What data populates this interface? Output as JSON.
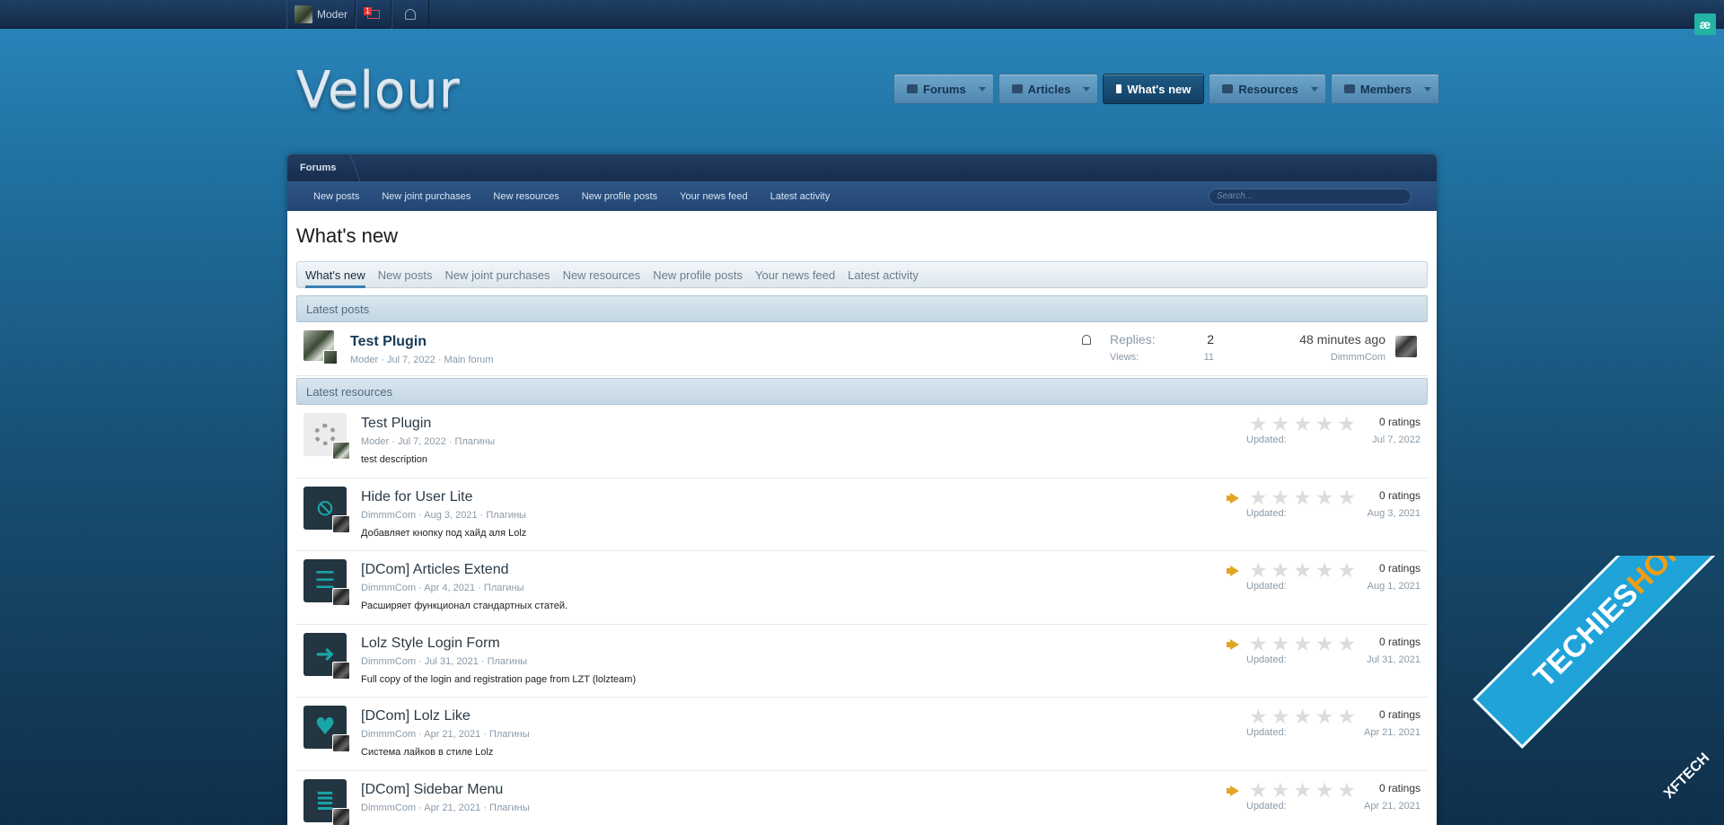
{
  "topbar": {
    "username": "Moder",
    "mail_badge": "1"
  },
  "corner_badge": "æ",
  "logo": "Velour",
  "mainnav": [
    {
      "label": "Forums",
      "icon": "comments-icon",
      "active": false
    },
    {
      "label": "Articles",
      "icon": "newspaper-icon",
      "active": false
    },
    {
      "label": "What's new",
      "icon": "bolt-icon",
      "active": true
    },
    {
      "label": "Resources",
      "icon": "download-icon",
      "active": false
    },
    {
      "label": "Members",
      "icon": "users-icon",
      "active": false
    }
  ],
  "breadcrumb": "Forums",
  "subnav": [
    "New posts",
    "New joint purchases",
    "New resources",
    "New profile posts",
    "Your news feed",
    "Latest activity"
  ],
  "search_placeholder": "Search...",
  "page_title": "What's new",
  "tabs": [
    "What's new",
    "New posts",
    "New joint purchases",
    "New resources",
    "New profile posts",
    "Your news feed",
    "Latest activity"
  ],
  "latest_posts_heading": "Latest posts",
  "post": {
    "title": "Test Plugin",
    "meta": "Moder · Jul 7, 2022 · Main forum",
    "replies_label": "Replies:",
    "replies": "2",
    "views_label": "Views:",
    "views": "11",
    "last_time": "48 minutes ago",
    "last_user": "DimmmCom"
  },
  "latest_resources_heading": "Latest resources",
  "resources": [
    {
      "title": "Test Plugin",
      "meta": "Moder · Jul 7, 2022 · Плагины",
      "desc": "test description",
      "ratings": "0 ratings",
      "updated_label": "Updated:",
      "updated": "Jul 7, 2022",
      "featured": false,
      "icon": "gear-icon"
    },
    {
      "title": "Hide for User Lite",
      "meta": "DimmmCom · Aug 3, 2021 · Плагины",
      "desc": "Добавляет кнопку под хайд аля Lolz",
      "ratings": "0 ratings",
      "updated_label": "Updated:",
      "updated": "Aug 3, 2021",
      "featured": true,
      "icon": "eye-slash-icon"
    },
    {
      "title": "[DCom] Articles Extend",
      "meta": "DimmmCom · Apr 4, 2021 · Плагины",
      "desc": "Расширяет функционал стандартных статей.",
      "ratings": "0 ratings",
      "updated_label": "Updated:",
      "updated": "Aug 1, 2021",
      "featured": true,
      "icon": "article-icon"
    },
    {
      "title": "Lolz Style Login Form",
      "meta": "DimmmCom · Jul 31, 2021 · Плагины",
      "desc": "Full copy of the login and registration page from LZT (lolzteam)",
      "ratings": "0 ratings",
      "updated_label": "Updated:",
      "updated": "Jul 31, 2021",
      "featured": true,
      "icon": "sign-in-icon"
    },
    {
      "title": "[DCom] Lolz Like",
      "meta": "DimmmCom · Apr 21, 2021 · Плагины",
      "desc": "Система лайков в стиле Lolz",
      "ratings": "0 ratings",
      "updated_label": "Updated:",
      "updated": "Apr 21, 2021",
      "featured": false,
      "icon": "heart-icon"
    },
    {
      "title": "[DCom] Sidebar Menu",
      "meta": "DimmmCom · Apr 21, 2021 · Плагины",
      "desc": "",
      "ratings": "0 ratings",
      "updated_label": "Updated:",
      "updated": "Apr 21, 2021",
      "featured": true,
      "icon": "list-icon"
    }
  ],
  "watermark": {
    "part1": "TECHIES",
    "part2": "HOME.COM",
    "part3": "XFTECH"
  }
}
